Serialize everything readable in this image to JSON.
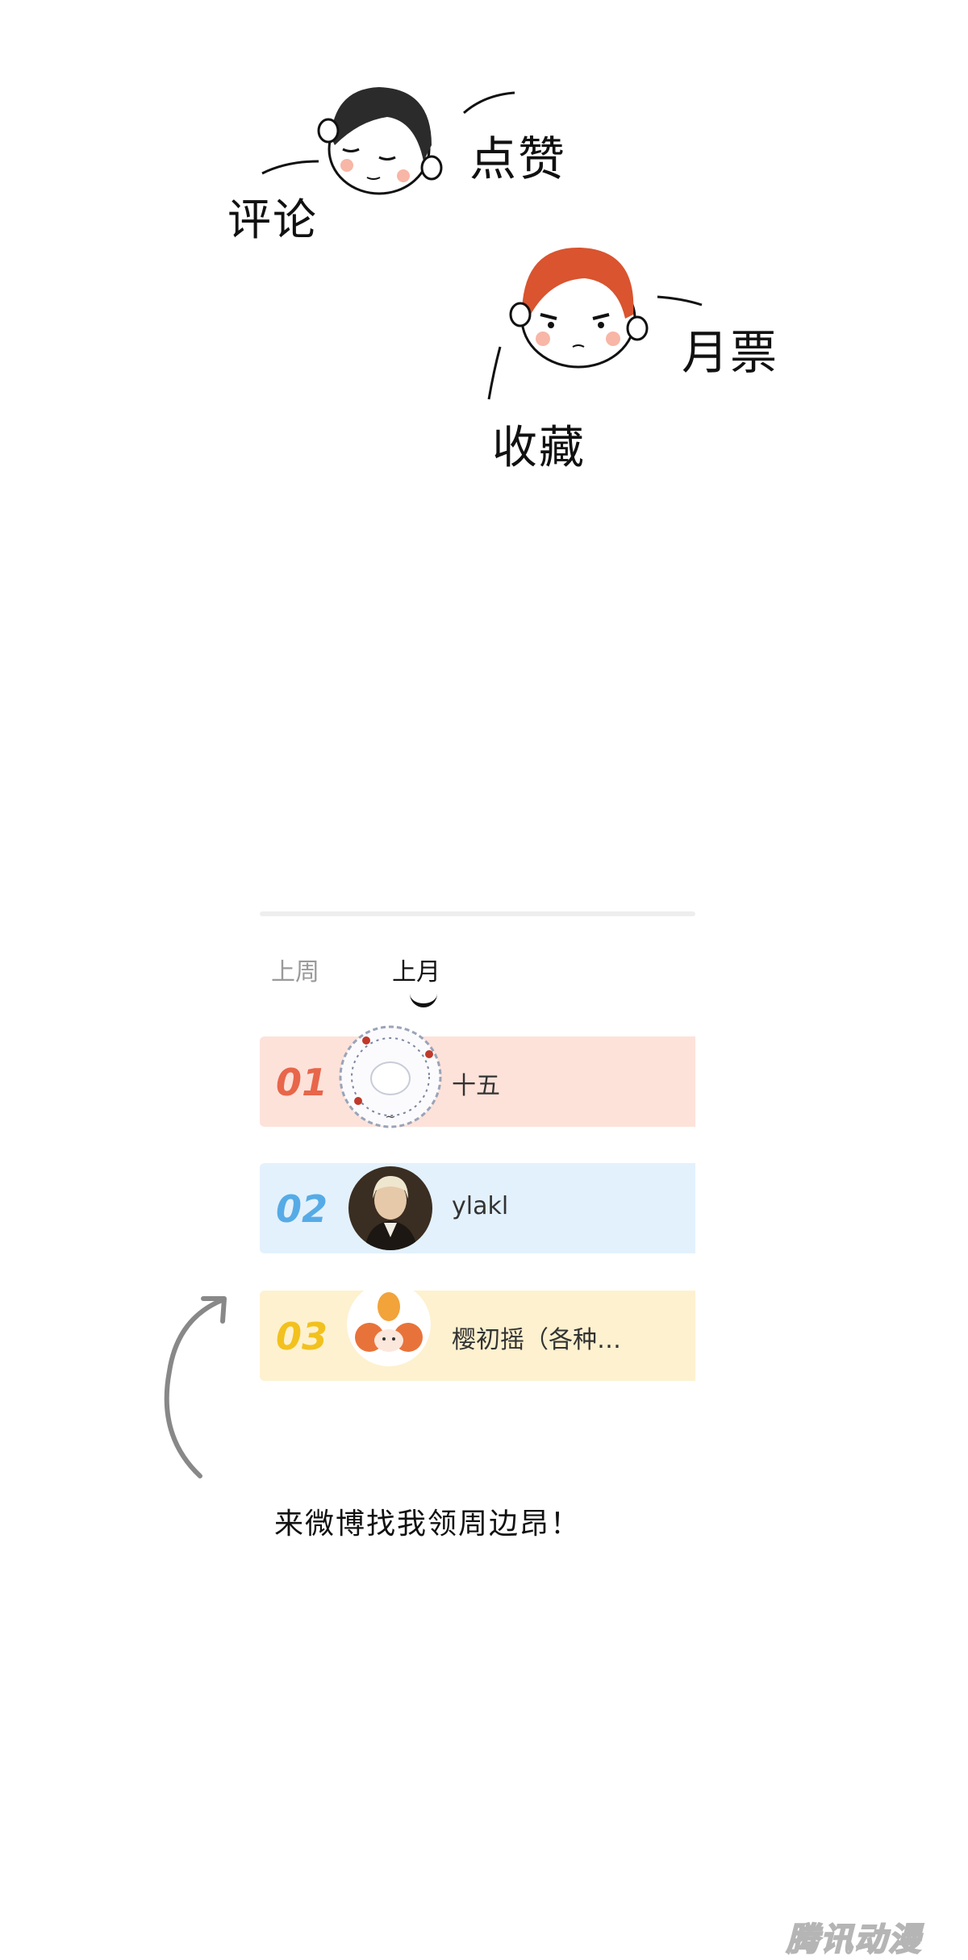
{
  "doodles": {
    "labels": {
      "comment": "评论",
      "like": "点赞",
      "monthly_ticket": "月票",
      "favorite": "收藏"
    }
  },
  "ranking": {
    "tabs": [
      {
        "label": "上周",
        "active": false
      },
      {
        "label": "上月",
        "active": true
      }
    ],
    "rows": [
      {
        "rank": "01",
        "name": "十五",
        "color": "#fde2da",
        "rank_color": "#e8664a"
      },
      {
        "rank": "02",
        "name": "ylakl",
        "color": "#e3f1fc",
        "rank_color": "#56abe6"
      },
      {
        "rank": "03",
        "name": "樱初摇（各种…",
        "color": "#fdf1cf",
        "rank_color": "#f2c11e"
      }
    ]
  },
  "footer": {
    "weibo_text": "来微博找我领周边昂！",
    "watermark": "腾讯动漫"
  }
}
